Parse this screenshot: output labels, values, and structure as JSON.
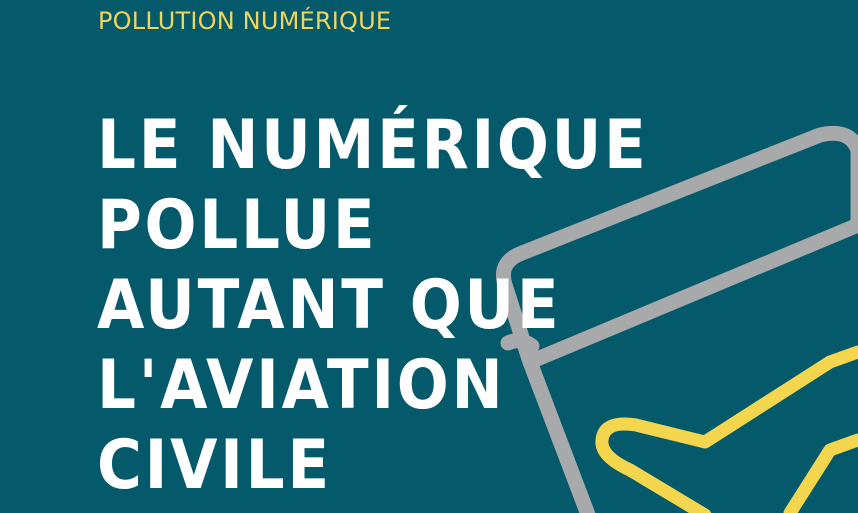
{
  "kicker": "POLLUTION NUMÉRIQUE",
  "headline": {
    "lines": [
      "LE NUMÉRIQUE",
      "POLLUE",
      "AUTANT QUE",
      "L'AVIATION",
      "CIVILE"
    ]
  },
  "colors": {
    "background": "#04596a",
    "kicker": "#f0d55a",
    "headline": "#ffffff",
    "laptop_outline": "#a7a9ab",
    "airplane_outline": "#f4d64e"
  },
  "icons": [
    "laptop-icon",
    "airplane-icon"
  ]
}
